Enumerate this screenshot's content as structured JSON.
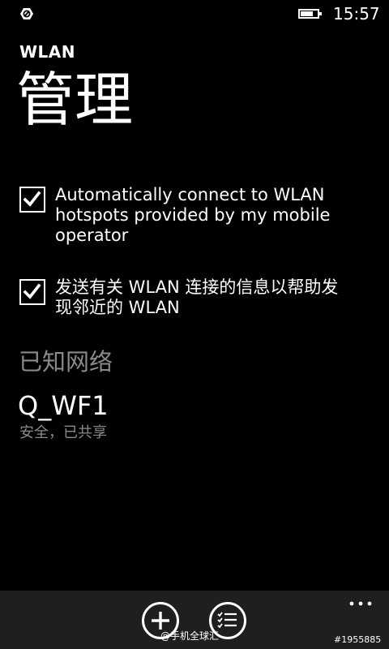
{
  "status_bar": {
    "time": "15:57",
    "battery_level": 0.7,
    "left_icon": "data-sense-icon",
    "battery_icon": "battery-icon"
  },
  "header": {
    "app_title": "WLAN",
    "page_title": "管理"
  },
  "settings": {
    "auto_connect": {
      "checked": true,
      "label": "Automatically connect to WLAN hotspots provided by my mobile operator"
    },
    "send_info": {
      "checked": true,
      "label": "发送有关 WLAN 连接的信息以帮助发现邻近的 WLAN"
    }
  },
  "known_networks": {
    "heading": "已知网络",
    "items": [
      {
        "name": "Q_WF1",
        "status": "安全，已共享"
      }
    ]
  },
  "app_bar": {
    "add_icon": "add-icon",
    "select_icon": "select-list-icon",
    "more_icon": "more-icon",
    "background": "#1f1f1f"
  },
  "watermark": {
    "brand": "@手机全球汇",
    "id": "#1955885"
  },
  "colors": {
    "background": "#000000",
    "foreground": "#ffffff",
    "secondary_text": "#8a8a8a"
  }
}
